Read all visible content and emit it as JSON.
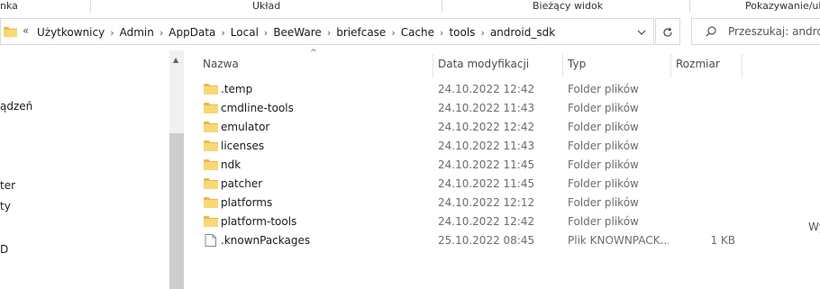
{
  "ribbon": {
    "groups": [
      "nka",
      "Układ",
      "Bieżący widok",
      "Pokazywanie/uk"
    ]
  },
  "address": {
    "overflow_label": "«",
    "breadcrumbs": [
      "Użytkownicy",
      "Admin",
      "AppData",
      "Local",
      "BeeWare",
      "briefcase",
      "Cache",
      "tools",
      "android_sdk"
    ],
    "separator": "›",
    "dropdown_icon": "chevron-down-icon",
    "refresh_icon": "refresh-icon"
  },
  "search": {
    "placeholder": "Przeszukaj: android_sdk"
  },
  "nav": {
    "items": [
      "ądzeń",
      "ter",
      "ty",
      "D"
    ]
  },
  "columns": {
    "name": "Nazwa",
    "date": "Data modyfikacji",
    "type": "Typ",
    "size": "Rozmiar"
  },
  "files": [
    {
      "name": ".temp",
      "date": "24.10.2022 12:42",
      "type": "Folder plików",
      "size": "",
      "kind": "folder"
    },
    {
      "name": "cmdline-tools",
      "date": "24.10.2022 11:43",
      "type": "Folder plików",
      "size": "",
      "kind": "folder"
    },
    {
      "name": "emulator",
      "date": "24.10.2022 12:42",
      "type": "Folder plików",
      "size": "",
      "kind": "folder"
    },
    {
      "name": "licenses",
      "date": "24.10.2022 11:43",
      "type": "Folder plików",
      "size": "",
      "kind": "folder"
    },
    {
      "name": "ndk",
      "date": "24.10.2022 11:45",
      "type": "Folder plików",
      "size": "",
      "kind": "folder"
    },
    {
      "name": "patcher",
      "date": "24.10.2022 11:45",
      "type": "Folder plików",
      "size": "",
      "kind": "folder"
    },
    {
      "name": "platforms",
      "date": "24.10.2022 12:12",
      "type": "Folder plików",
      "size": "",
      "kind": "folder"
    },
    {
      "name": "platform-tools",
      "date": "24.10.2022 12:42",
      "type": "Folder plików",
      "size": "",
      "kind": "folder"
    },
    {
      "name": ".knownPackages",
      "date": "25.10.2022 08:45",
      "type": "Plik KNOWNPACK...",
      "size": "1 KB",
      "kind": "file"
    }
  ],
  "right_hint": "Wy",
  "colors": {
    "folder_yellow": "#f8d775",
    "folder_dark": "#e8b84a",
    "secondary_text": "#6d6d6d",
    "border": "#d9d9d9"
  }
}
